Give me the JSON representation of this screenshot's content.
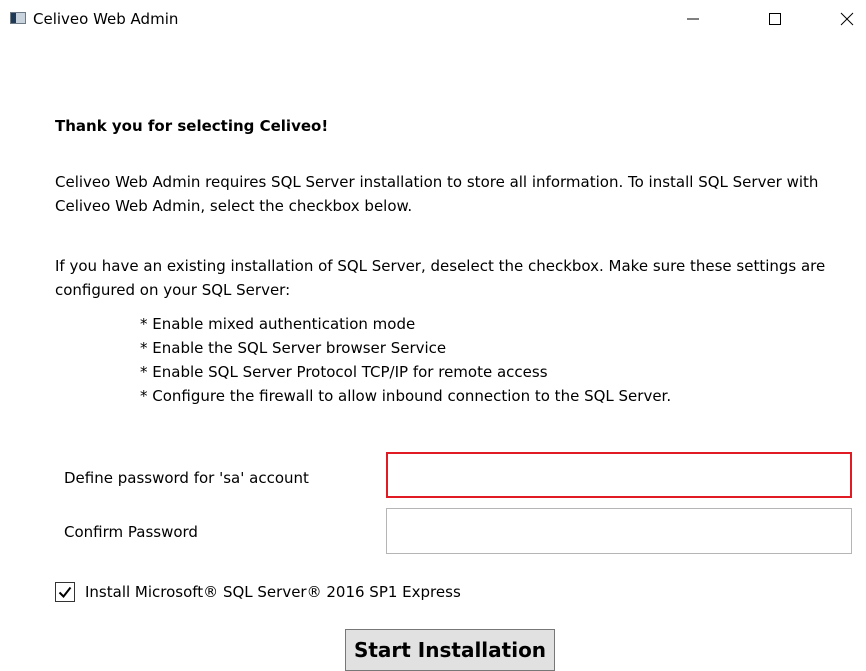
{
  "window": {
    "title": "Celiveo Web Admin",
    "controls": {
      "minimize": "minimize-icon",
      "maximize": "maximize-icon",
      "close": "close-icon"
    }
  },
  "main": {
    "heading": "Thank you for selecting Celiveo!",
    "paragraph1": "Celiveo Web Admin requires SQL Server installation to store all information. To install  SQL Server with Celiveo Web Admin, select the checkbox below.",
    "paragraph2": "If you have an existing installation of SQL Server, deselect the checkbox. Make sure these settings are configured on your SQL Server:",
    "requirements": [
      "* Enable mixed authentication mode",
      "* Enable the SQL Server browser Service",
      "* Enable SQL Server Protocol TCP/IP for remote access",
      "* Configure the firewall to allow inbound connection to the SQL Server."
    ]
  },
  "form": {
    "password_label": "Define password for 'sa' account",
    "password_value": "",
    "confirm_label": "Confirm Password",
    "confirm_value": "",
    "install_checkbox_label": "Install Microsoft® SQL Server® 2016 SP1 Express",
    "install_checked": true,
    "start_button_label": "Start Installation"
  },
  "colors": {
    "error_border": "#e01b24",
    "button_bg": "#e1e1e1"
  }
}
